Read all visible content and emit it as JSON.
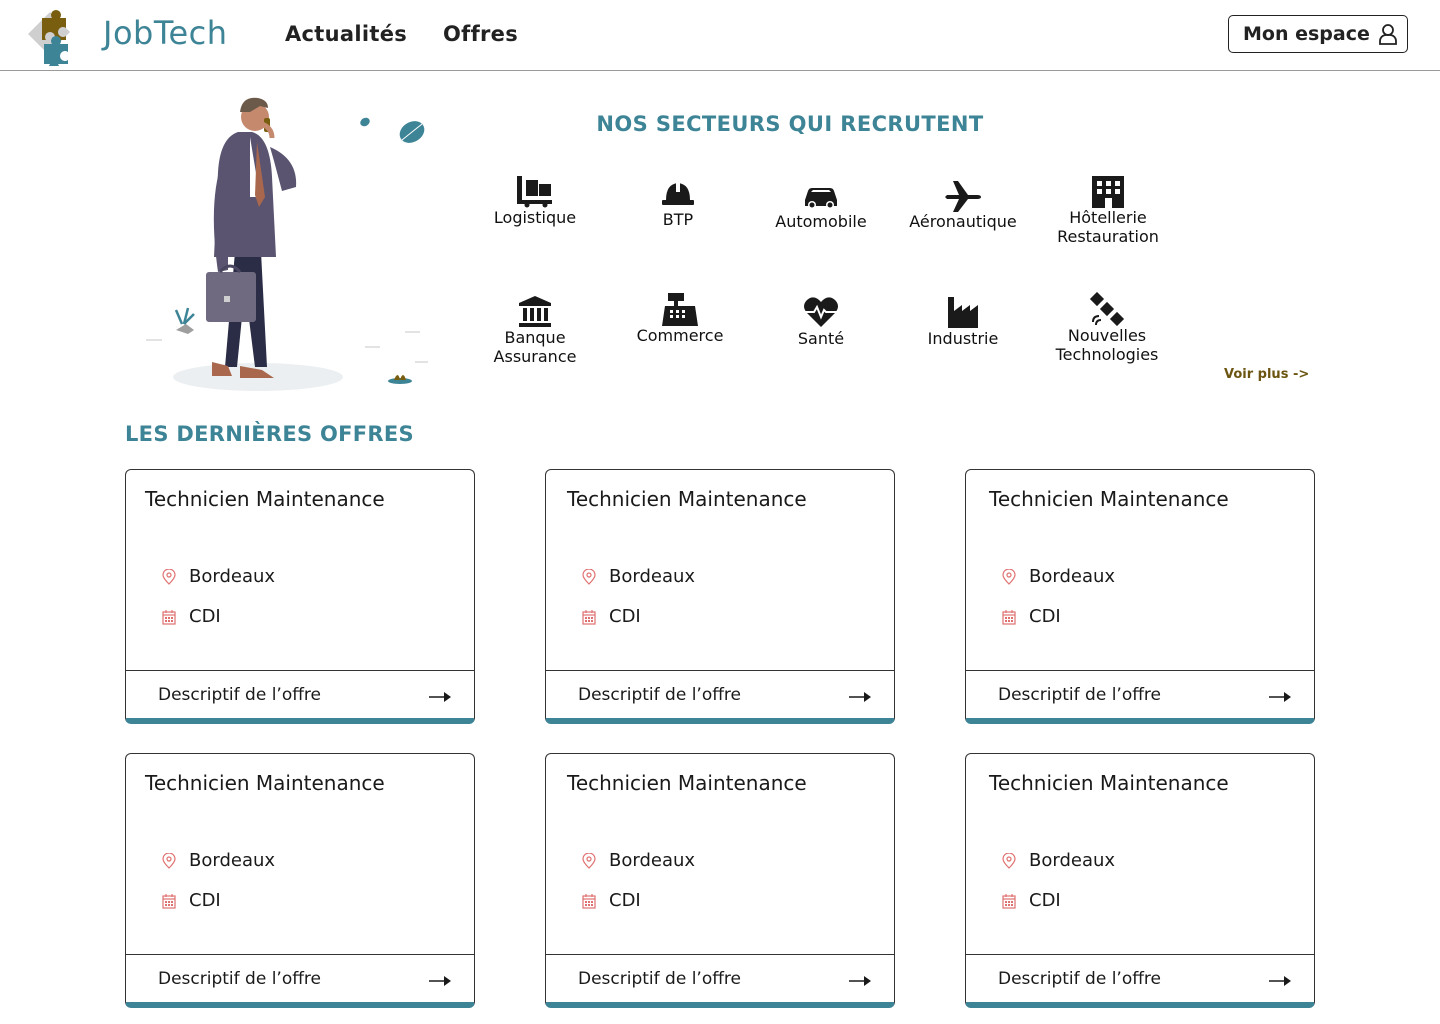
{
  "header": {
    "brand": "JobTech",
    "nav": [
      {
        "label": "Actualités"
      },
      {
        "label": "Offres"
      }
    ],
    "account_label": "Mon espace"
  },
  "sectors": {
    "title": "NOS SECTEURS QUI RECRUTENT",
    "items": [
      {
        "label": "Logistique",
        "icon": "pallet-jack-icon"
      },
      {
        "label": "BTP",
        "icon": "hard-hat-icon"
      },
      {
        "label": "Automobile",
        "icon": "car-icon"
      },
      {
        "label": "Aéronautique",
        "icon": "airplane-icon"
      },
      {
        "label": "Hôtellerie\nRestauration",
        "icon": "hotel-icon"
      },
      {
        "label": "Banque\nAssurance",
        "icon": "bank-icon"
      },
      {
        "label": "Commerce",
        "icon": "cash-register-icon"
      },
      {
        "label": "Santé",
        "icon": "heartbeat-icon"
      },
      {
        "label": "Industrie",
        "icon": "factory-icon"
      },
      {
        "label": "Nouvelles\nTechnologies",
        "icon": "satellite-icon"
      }
    ],
    "more_label": "Voir plus ->"
  },
  "offers": {
    "title": "LES DERNIÈRES OFFRES",
    "cards": [
      {
        "title": "Technicien Maintenance",
        "location": "Bordeaux",
        "contract": "CDI",
        "action": "Descriptif de l’offre"
      },
      {
        "title": "Technicien Maintenance",
        "location": "Bordeaux",
        "contract": "CDI",
        "action": "Descriptif de l’offre"
      },
      {
        "title": "Technicien Maintenance",
        "location": "Bordeaux",
        "contract": "CDI",
        "action": "Descriptif de l’offre"
      },
      {
        "title": "Technicien Maintenance",
        "location": "Bordeaux",
        "contract": "CDI",
        "action": "Descriptif de l’offre"
      },
      {
        "title": "Technicien Maintenance",
        "location": "Bordeaux",
        "contract": "CDI",
        "action": "Descriptif de l’offre"
      },
      {
        "title": "Technicien Maintenance",
        "location": "Bordeaux",
        "contract": "CDI",
        "action": "Descriptif de l’offre"
      }
    ]
  },
  "colors": {
    "accent": "#3d8496",
    "brand_gold": "#7a5e10",
    "icon_red": "#e07070",
    "text": "#1a1a1a"
  }
}
